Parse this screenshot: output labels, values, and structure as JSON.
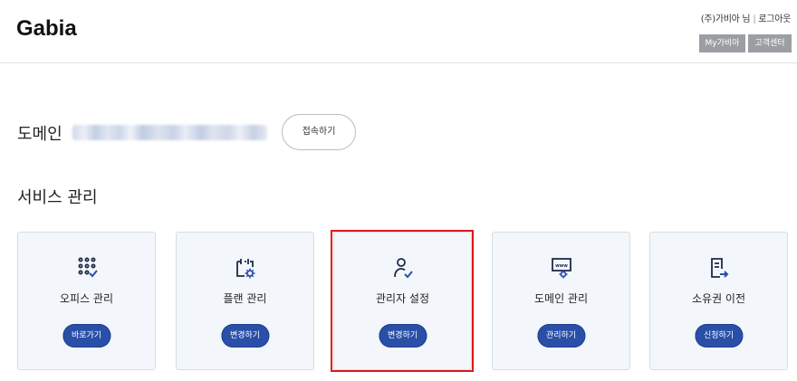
{
  "header": {
    "logo": "Gabia",
    "user_name": "(주)가비아 님",
    "logout": "로그아웃",
    "my_button": "My가비아",
    "support_button": "고객센터"
  },
  "domain": {
    "label": "도메인",
    "connect_button": "접속하기"
  },
  "services": {
    "title": "서비스 관리",
    "cards": [
      {
        "label": "오피스 관리",
        "button": "바로가기",
        "icon": "apps-grid-check-icon"
      },
      {
        "label": "플랜 관리",
        "button": "변경하기",
        "icon": "calendar-gear-icon"
      },
      {
        "label": "관리자 설정",
        "button": "변경하기",
        "icon": "user-check-icon"
      },
      {
        "label": "도메인 관리",
        "button": "관리하기",
        "icon": "www-monitor-gear-icon"
      },
      {
        "label": "소유권 이전",
        "button": "신청하기",
        "icon": "document-transfer-icon"
      }
    ]
  },
  "colors": {
    "accent": "#2a4fa8",
    "card_bg": "#f3f6fa",
    "highlight": "#e0161b",
    "header_button": "#9b9ea3"
  }
}
